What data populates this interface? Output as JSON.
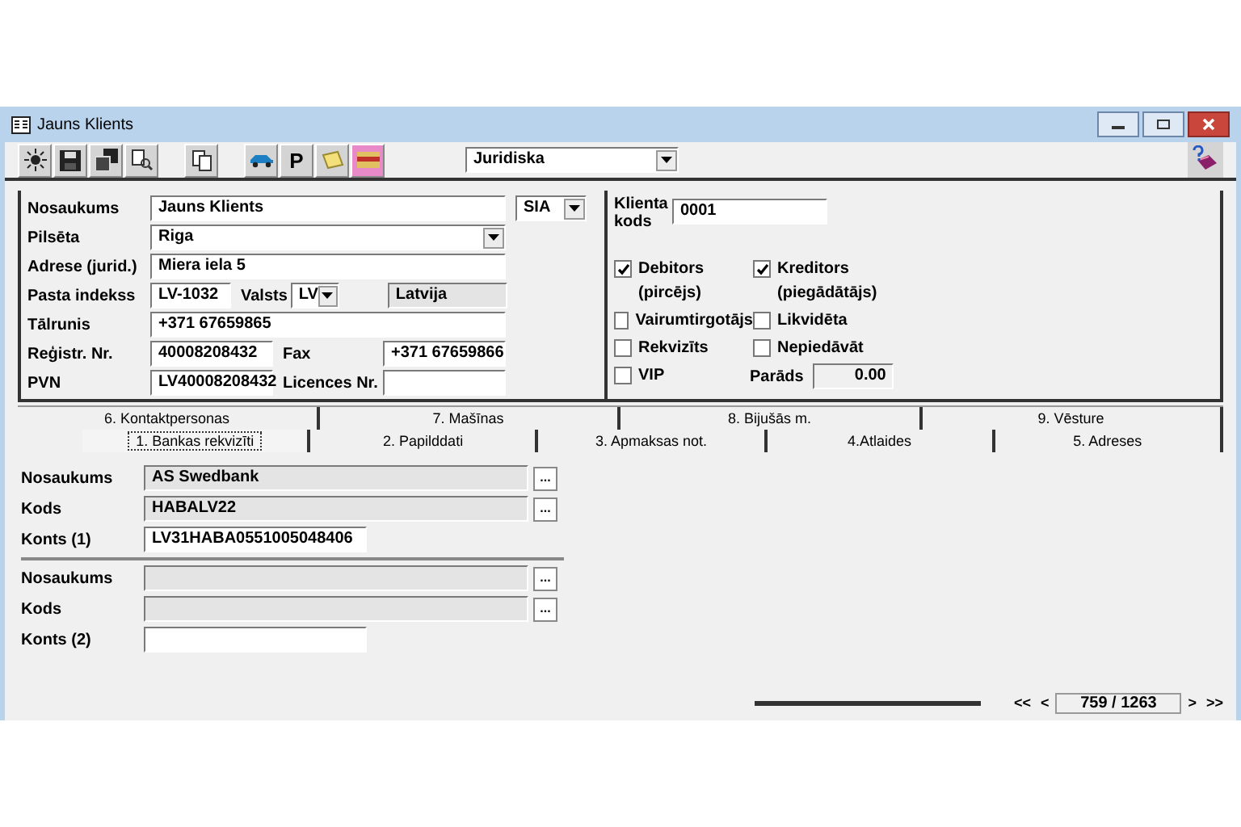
{
  "window": {
    "title": "Jauns Klients"
  },
  "toolbar": {
    "p_button": "P",
    "type_select": "Juridiska"
  },
  "main": {
    "name": {
      "label": "Nosaukums",
      "value": "Jauns Klients",
      "form": "SIA"
    },
    "city": {
      "label": "Pilsēta",
      "value": "Riga"
    },
    "address": {
      "label": "Adrese (jurid.)",
      "value": "Miera iela 5"
    },
    "postal": {
      "label": "Pasta indekss",
      "value": "LV-1032",
      "country_label": "Valsts",
      "country_code": "LV",
      "country_name": "Latvija"
    },
    "phone": {
      "label": "Tālrunis",
      "value": "+371 67659865"
    },
    "reg": {
      "label": "Reģistr. Nr.",
      "value": "40008208432",
      "fax_label": "Fax",
      "fax_value": "+371 67659866"
    },
    "vat": {
      "label": "PVN",
      "value": "LV40008208432",
      "licence_label": "Licences Nr."
    }
  },
  "side": {
    "code_label": "Klienta kods",
    "code_value": "0001",
    "checkboxes": [
      {
        "label": "Debitors",
        "sublabel": "(pircējs)",
        "checked": true
      },
      {
        "label": "Kreditors",
        "sublabel": "(piegādātājs)",
        "checked": true
      },
      {
        "label": "Vairumtirgotājs",
        "checked": false
      },
      {
        "label": "Likvidēta",
        "checked": false
      },
      {
        "label": "Rekvizīts",
        "checked": false
      },
      {
        "label": "Nepiedāvāt",
        "checked": false
      },
      {
        "label": "VIP",
        "checked": false
      }
    ],
    "debt_label": "Parāds",
    "debt_value": "0.00"
  },
  "tabs_back": [
    {
      "label": "6. Kontaktpersonas",
      "selected": false
    },
    {
      "label": "7. Mašīnas",
      "selected": false
    },
    {
      "label": "8. Bijušās m.",
      "selected": false
    },
    {
      "label": "9. Vēsture",
      "selected": false
    }
  ],
  "tabs_front": [
    {
      "label": "1. Bankas rekvizīti",
      "selected": true
    },
    {
      "label": "2. Papilddati",
      "selected": false
    },
    {
      "label": "3. Apmaksas not.",
      "selected": false
    },
    {
      "label": "4.Atlaides",
      "selected": false
    },
    {
      "label": "5. Adreses",
      "selected": false
    }
  ],
  "bank_groups": [
    [
      {
        "kind": "lookup",
        "label": "Nosaukums",
        "value": "AS Swedbank",
        "button": "..."
      },
      {
        "kind": "lookup",
        "label": "Kods",
        "value": "HABALV22",
        "button": "..."
      },
      {
        "kind": "input",
        "label": "Konts (1)",
        "value": "LV31HABA0551005048406"
      }
    ],
    [
      {
        "kind": "lookup",
        "label": "Nosaukums",
        "button": "..."
      },
      {
        "kind": "lookup",
        "label": "Kods",
        "button": "..."
      },
      {
        "kind": "input",
        "label": "Konts (2)"
      }
    ]
  ],
  "nav": {
    "first": "<<",
    "prev": "<",
    "record": "759 / 1263",
    "next": ">",
    "last": ">>"
  }
}
